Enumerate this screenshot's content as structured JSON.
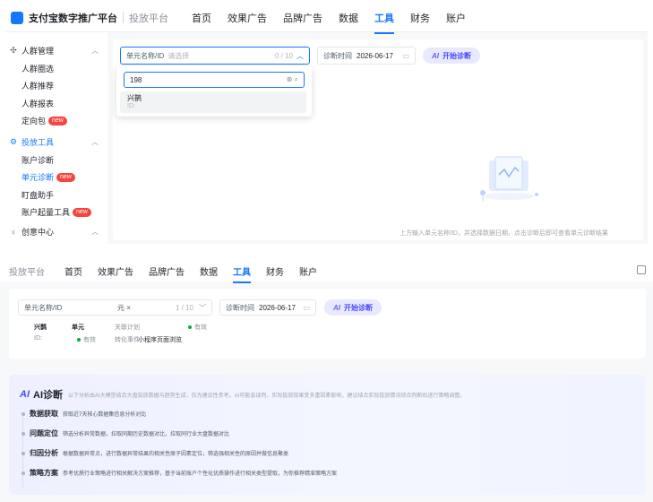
{
  "top": {
    "brand": "支付宝数字推广平台",
    "platform": "投放平台",
    "nav": [
      "首页",
      "效果广告",
      "品牌广告",
      "数据",
      "工具",
      "财务",
      "账户"
    ],
    "nav_active": 4,
    "sidebar": {
      "group1": "人群管理",
      "group1_items": [
        "人群圈选",
        "人群推荐",
        "人群报表",
        "定向包"
      ],
      "group2": "投放工具",
      "group2_items": [
        "账户诊断",
        "单元诊断",
        "盯盘助手",
        "账户起量工具"
      ],
      "group3": "创意中心",
      "new_badge": "new"
    },
    "unit_select": {
      "label": "单元名称/ID",
      "placeholder": "请选择",
      "count": "0 / 10"
    },
    "date": {
      "label": "诊断时间",
      "value": "2026-06-17"
    },
    "start_button": "开始诊断",
    "dropdown": {
      "search_value": "198",
      "option_name": "兴鹊",
      "option_id": "ID:"
    },
    "empty_hint": "上方输入单元名称/ID，并选择数据日期，点击诊断后即可查看单元诊断结果"
  },
  "bottom": {
    "platform": "投放平台",
    "nav": [
      "首页",
      "效果广告",
      "品牌广告",
      "数据",
      "工具",
      "财务",
      "账户"
    ],
    "nav_active": 4,
    "unit_select": {
      "label": "单元名称/ID",
      "tag": "元 ×",
      "count": "1 / 10"
    },
    "date": {
      "label": "诊断时间",
      "value": "2026-06-17"
    },
    "start_button": "开始诊断",
    "unit": {
      "name": "兴鹊",
      "id": "ID:",
      "col_unit": "单元",
      "status": "有效",
      "col_plan": "关联计划",
      "plan_status": "有效",
      "conv_label": "转化事件",
      "conv_value": "小程序页面浏览"
    },
    "ai": {
      "title": "AI诊断",
      "desc": "以下分析由AI大模型结合大盘投放数据与趋势生成，仅为建议性参考。AI可能会误判，实际投放效果受多重因素影响，建议结合实际投放情况综合判断后进行策略调整。",
      "steps": [
        {
          "name": "数据获取",
          "desc": "获取近7天核心数据集信息分析对比"
        },
        {
          "name": "问题定位",
          "desc": "筛选分析异常数据，拉取同期历史数据对比，拉取同行业大盘数据对比"
        },
        {
          "name": "归因分析",
          "desc": "根据数据异常点，进行数据异常结果的相关性原子因素定位，筛选强相关性的原因并做信息聚类"
        },
        {
          "name": "策略方案",
          "desc": "参考优质行业策略进行相关解决方案推荐，基于当前账户个性化优质操作进行相关类型提取，为你推荐精准策略方案"
        }
      ]
    }
  }
}
